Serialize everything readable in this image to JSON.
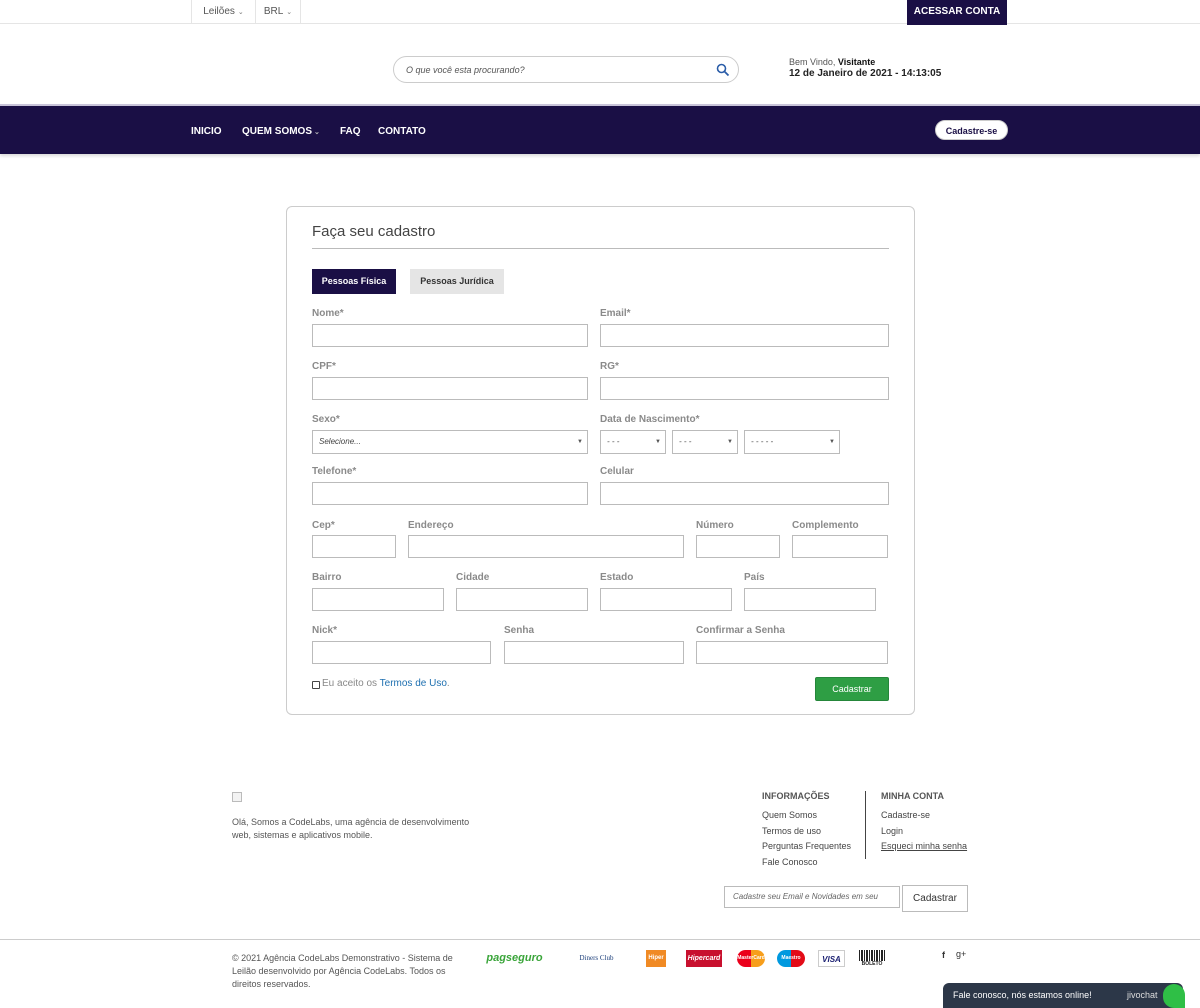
{
  "topbar": {
    "auctions_label": "Leilões",
    "currency_label": "BRL",
    "access_account_label": "ACESSAR CONTA"
  },
  "header": {
    "search_placeholder": "O que você esta procurando?",
    "welcome_prefix": "Bem Vindo,",
    "welcome_user": "Visitante",
    "datetime": "12 de Janeiro de 2021 - 14:13:05"
  },
  "nav": {
    "items": [
      {
        "label": "INICIO"
      },
      {
        "label": "QUEM SOMOS"
      },
      {
        "label": "FAQ"
      },
      {
        "label": "CONTATO"
      }
    ],
    "signup_label": "Cadastre-se"
  },
  "form": {
    "title": "Faça seu cadastro",
    "tabs": [
      {
        "label": "Pessoas Física",
        "active": true
      },
      {
        "label": "Pessoas Jurídica",
        "active": false
      }
    ],
    "labels": {
      "nome": "Nome*",
      "email": "Email*",
      "cpf": "CPF*",
      "rg": "RG*",
      "sexo": "Sexo*",
      "nascimento": "Data de Nascimento*",
      "telefone": "Telefone*",
      "celular": "Celular",
      "cep": "Cep*",
      "endereco": "Endereço",
      "numero": "Número",
      "complemento": "Complemento",
      "bairro": "Bairro",
      "cidade": "Cidade",
      "estado": "Estado",
      "pais": "País",
      "nick": "Nick*",
      "senha": "Senha",
      "confirmar": "Confirmar a Senha"
    },
    "sexo_selected": "Selecione...",
    "dia_selected": "- - -",
    "mes_selected": "- - -",
    "ano_selected": "- - - - -",
    "terms_prefix": "Eu aceito os ",
    "terms_link": "Termos de Uso",
    "terms_suffix": ".",
    "submit_label": "Cadastrar"
  },
  "footer": {
    "about": "Olá, Somos a CodeLabs, uma agência de desenvolvimento web, sistemas e aplicativos mobile.",
    "info_title": "INFORMAÇÕES",
    "info_links": [
      "Quem Somos",
      "Termos de uso",
      "Perguntas Frequentes",
      "Fale Conosco"
    ],
    "account_title": "MINHA CONTA",
    "account_links": [
      "Cadastre-se",
      "Login",
      "Esqueci minha senha"
    ],
    "newsletter_placeholder": "Cadastre seu Email e Novidades em seu",
    "newsletter_button": "Cadastrar",
    "copyright": "© 2021 Agência CodeLabs Demonstrativo - Sistema de Leilão desenvolvido por Agência CodeLabs. Todos os direitos reservados.",
    "payments": [
      "pagseguro",
      "Diners Club",
      "Hiper",
      "Hipercard",
      "MasterCard",
      "Maestro",
      "VISA",
      "BOLETO"
    ],
    "social": [
      "f",
      "g+"
    ]
  },
  "chat": {
    "text": "Fale conosco, nós estamos online!",
    "brand": "jivochat"
  },
  "colors": {
    "brand": "#1a0f45",
    "submit": "#2e9e44",
    "link": "#1d6fb0",
    "chat": "#2c3748"
  }
}
